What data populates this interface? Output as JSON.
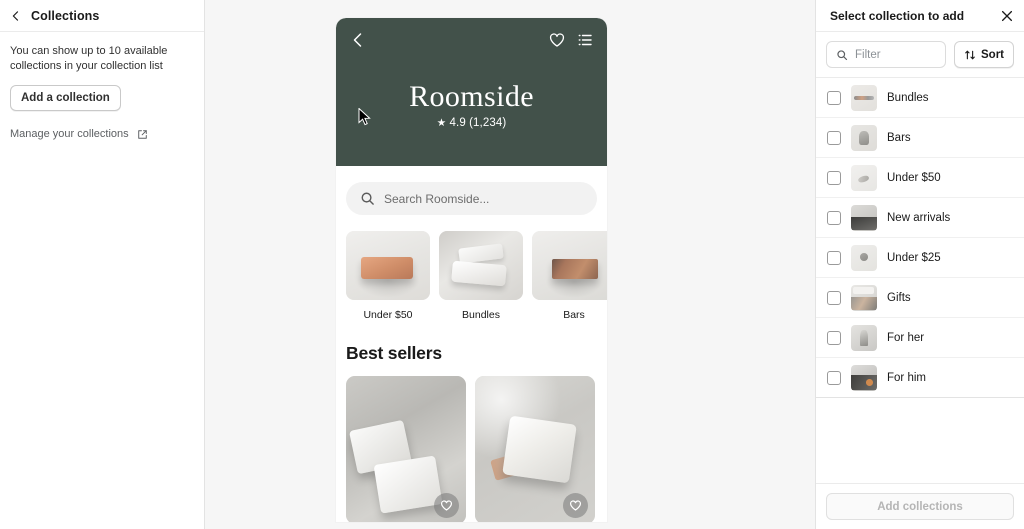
{
  "sidebar": {
    "back_icon": "chevron-left-icon",
    "title": "Collections",
    "note": "You can show up to 10 available collections in your collection list",
    "add_button": "Add a collection",
    "manage_link": "Manage your collections",
    "manage_link_icon": "external-link-icon"
  },
  "preview": {
    "back_icon": "chevron-left-icon",
    "favorite_icon": "heart-icon",
    "menu_icon": "list-icon",
    "shop_name": "Roomside",
    "rating_star": "★",
    "rating_text": "4.9 (1,234)",
    "hero_color": "#42514a",
    "search": {
      "icon": "search-icon",
      "placeholder": "Search Roomside..."
    },
    "categories": [
      {
        "label": "Under $50",
        "thumb": "soap-bar-tan-photo"
      },
      {
        "label": "Bundles",
        "thumb": "stacked-white-soaps-photo"
      },
      {
        "label": "Bars",
        "thumb": "brown-soap-bar-photo"
      }
    ],
    "section_title": "Best sellers",
    "products": [
      {
        "thumb": "two-white-soap-bars-photo",
        "favorite_icon": "heart-icon"
      },
      {
        "thumb": "white-soap-pile-photo",
        "favorite_icon": "heart-icon"
      }
    ]
  },
  "panel": {
    "title": "Select collection to add",
    "close_icon": "close-icon",
    "filter": {
      "icon": "search-icon",
      "placeholder": "Filter",
      "value": ""
    },
    "sort_button": {
      "icon": "sort-arrows-icon",
      "label": "Sort"
    },
    "collections": [
      {
        "label": "Bundles",
        "checked": false,
        "thumb": "t1"
      },
      {
        "label": "Bars",
        "checked": false,
        "thumb": "t2"
      },
      {
        "label": "Under $50",
        "checked": false,
        "thumb": "t3"
      },
      {
        "label": "New arrivals",
        "checked": false,
        "thumb": "t4"
      },
      {
        "label": "Under $25",
        "checked": false,
        "thumb": "t5"
      },
      {
        "label": "Gifts",
        "checked": false,
        "thumb": "t6"
      },
      {
        "label": "For her",
        "checked": false,
        "thumb": "t7"
      },
      {
        "label": "For him",
        "checked": false,
        "thumb": "t8"
      }
    ],
    "footer_button": {
      "label": "Add collections",
      "disabled": true
    }
  }
}
